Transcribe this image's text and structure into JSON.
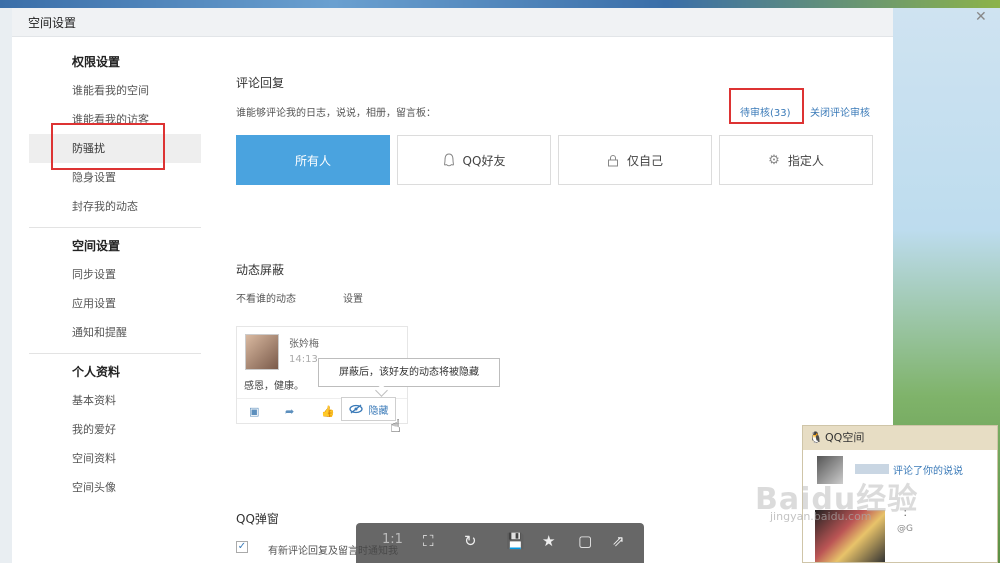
{
  "dialog": {
    "title": "空间设置"
  },
  "sidebar": {
    "groups": [
      {
        "heading": "权限设置",
        "items": [
          "谁能看我的空间",
          "谁能看我的访客",
          "防骚扰",
          "隐身设置",
          "封存我的动态"
        ]
      },
      {
        "heading": "空间设置",
        "items": [
          "同步设置",
          "应用设置",
          "通知和提醒"
        ]
      },
      {
        "heading": "个人资料",
        "items": [
          "基本资料",
          "我的爱好",
          "空间资料",
          "空间头像"
        ]
      }
    ],
    "active_item": "防骚扰"
  },
  "comment": {
    "title": "评论回复",
    "desc": "谁能够评论我的日志，说说，相册，留言板：",
    "pending": "待审核(33)",
    "close_review": "关闭评论审核",
    "options": [
      "所有人",
      "QQ好友",
      "仅自己",
      "指定人"
    ],
    "selected": "所有人"
  },
  "feed_block": {
    "title": "动态屏蔽",
    "label": "不看谁的动态",
    "settings": "设置",
    "card_name": "张妗梅",
    "card_time": "14:13",
    "card_body": "感恩，健康。",
    "hide_label": "隐藏",
    "tooltip": "屏蔽后，该好友的动态将被隐藏"
  },
  "popup": {
    "title": "QQ弹窗",
    "checkbox_label": "有新评论回复及留言时通知我",
    "checked": true
  },
  "viewer_bar": {
    "ratio": "1:1"
  },
  "qq_notify": {
    "title": "QQ空间",
    "message": "评论了你的说说",
    "mini1": "：",
    "mini2": "@G"
  },
  "watermark": {
    "brand": "Baidu经验",
    "url": "jingyan.baidu.com"
  },
  "colors": {
    "accent": "#4aa3df",
    "highlight_box": "#dd3333",
    "link": "#3a7ab8"
  }
}
